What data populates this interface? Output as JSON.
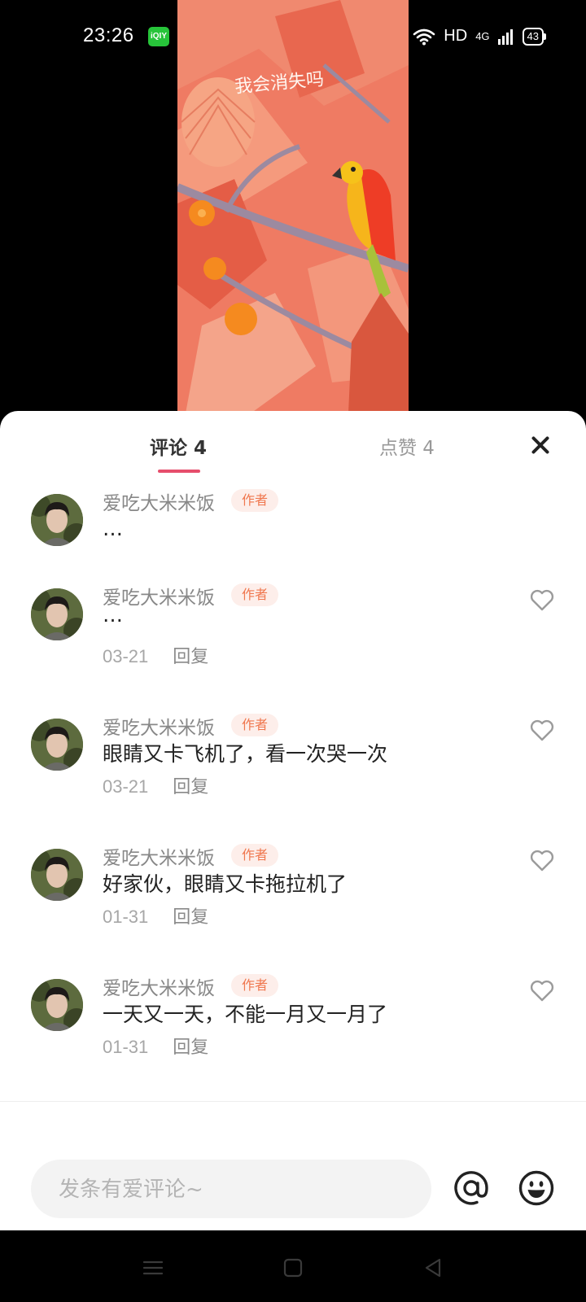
{
  "status_bar": {
    "time": "23:26",
    "app_badge": "iQIY",
    "network": "HD",
    "signal": "4G",
    "battery": "43"
  },
  "artwork": {
    "caption": "我会消失吗"
  },
  "tabs": {
    "comments": "评论 4",
    "likes": "点赞 4"
  },
  "comments": [
    {
      "user": "爱吃大米米饭",
      "badge": "作者",
      "text": "…",
      "date": "",
      "reply": ""
    },
    {
      "user": "爱吃大米米饭",
      "badge": "作者",
      "text": "…",
      "date": "03-21",
      "reply": "回复"
    },
    {
      "user": "爱吃大米米饭",
      "badge": "作者",
      "text": "眼睛又卡飞机了，看一次哭一次",
      "date": "03-21",
      "reply": "回复"
    },
    {
      "user": "爱吃大米米饭",
      "badge": "作者",
      "text": "好家伙，眼睛又卡拖拉机了",
      "date": "01-31",
      "reply": "回复"
    },
    {
      "user": "爱吃大米米饭",
      "badge": "作者",
      "text": "一天又一天，不能一月又一月了",
      "date": "01-31",
      "reply": "回复"
    }
  ],
  "input": {
    "placeholder": "发条有爱评论~"
  },
  "icons": {
    "close": "close-icon",
    "like": "heart-outline-icon",
    "mention": "at-icon",
    "emoji": "smiley-icon",
    "nav_menu": "menu-icon",
    "nav_home": "square-icon",
    "nav_back": "triangle-back-icon"
  },
  "colors": {
    "accent": "#e64e6c",
    "badge_text": "#f0774e",
    "badge_bg": "#fdeeea"
  }
}
